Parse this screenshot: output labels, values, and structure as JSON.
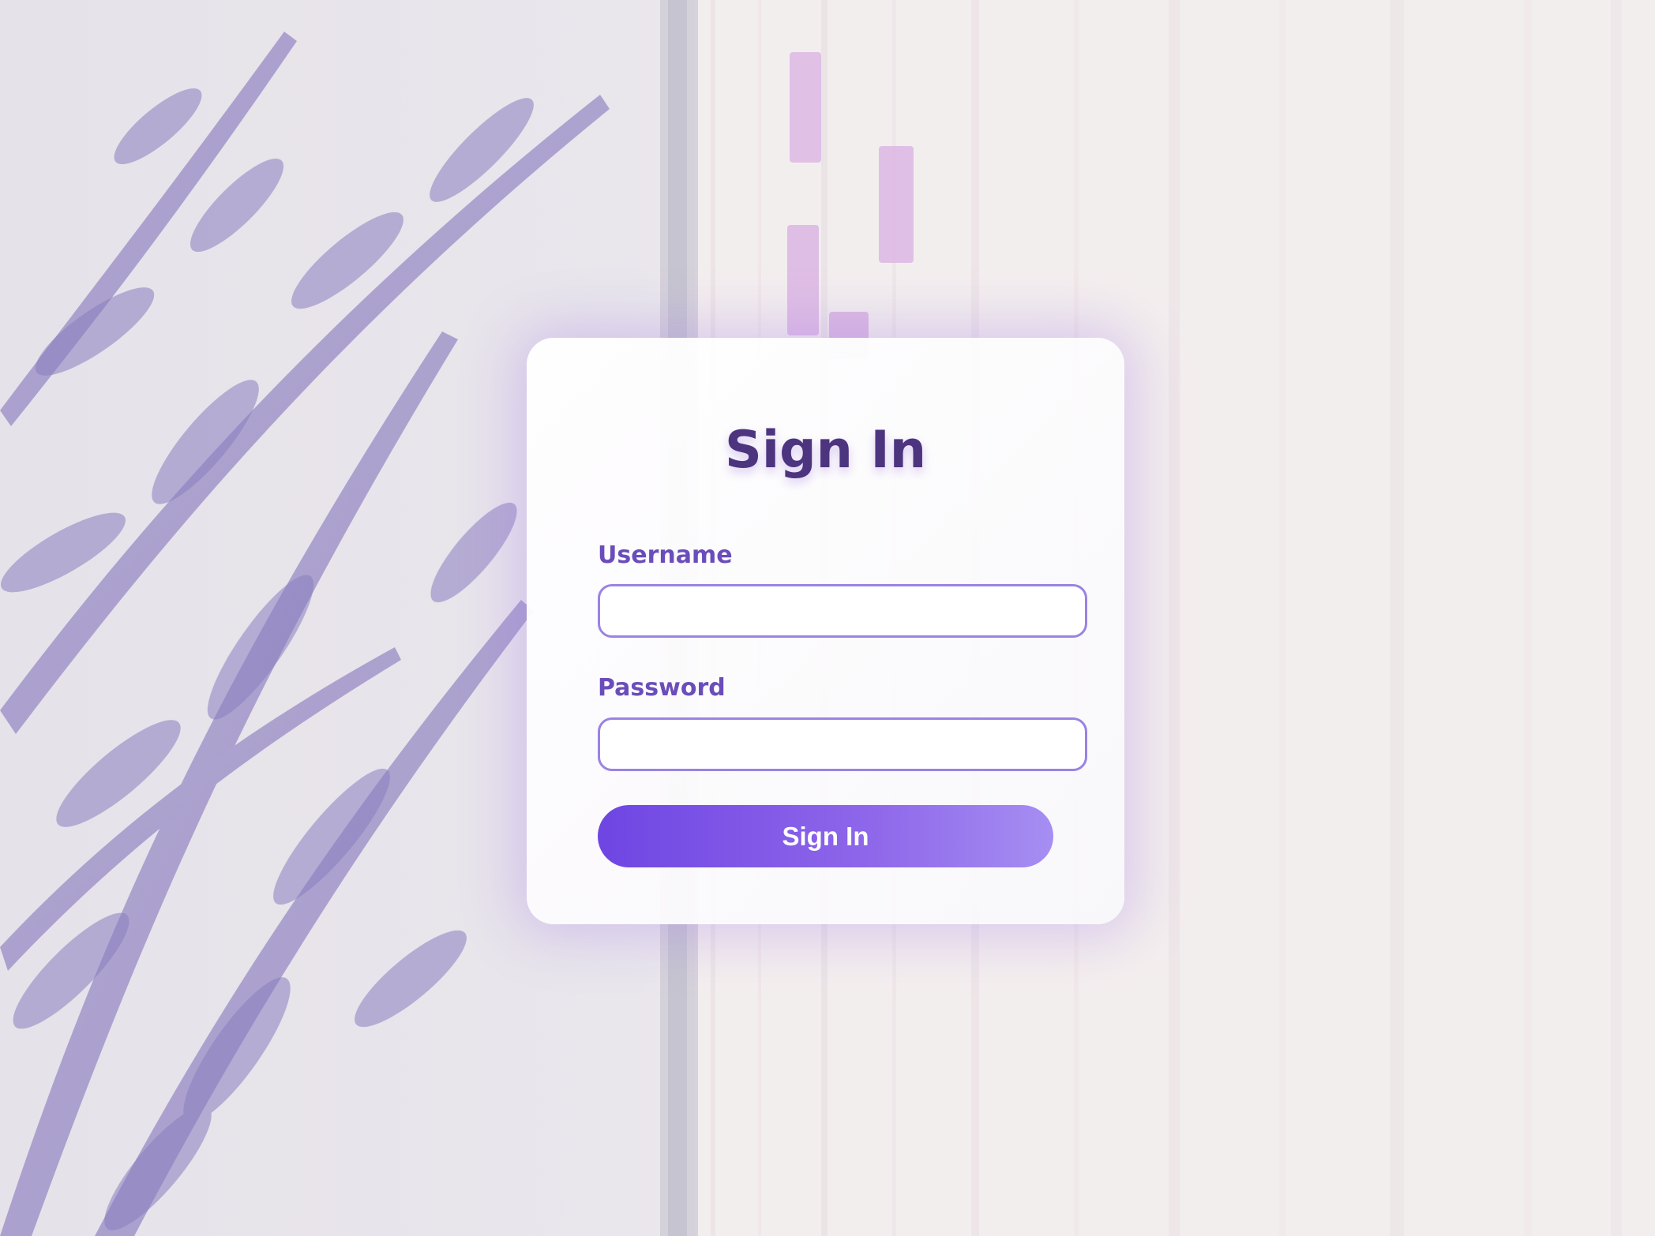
{
  "page": {
    "accent_color": "#6f45e3",
    "title_color": "#4d347f",
    "label_color": "#6a4dbb",
    "field_border_color": "#9a83e3"
  },
  "background": {
    "description_icon": "lavender-sprigs-and-book-pages-photo"
  },
  "login_card": {
    "title": "Sign In",
    "username_label": "Username",
    "username_value": "",
    "password_label": "Password",
    "password_value": "",
    "submit_label": "Sign In"
  }
}
